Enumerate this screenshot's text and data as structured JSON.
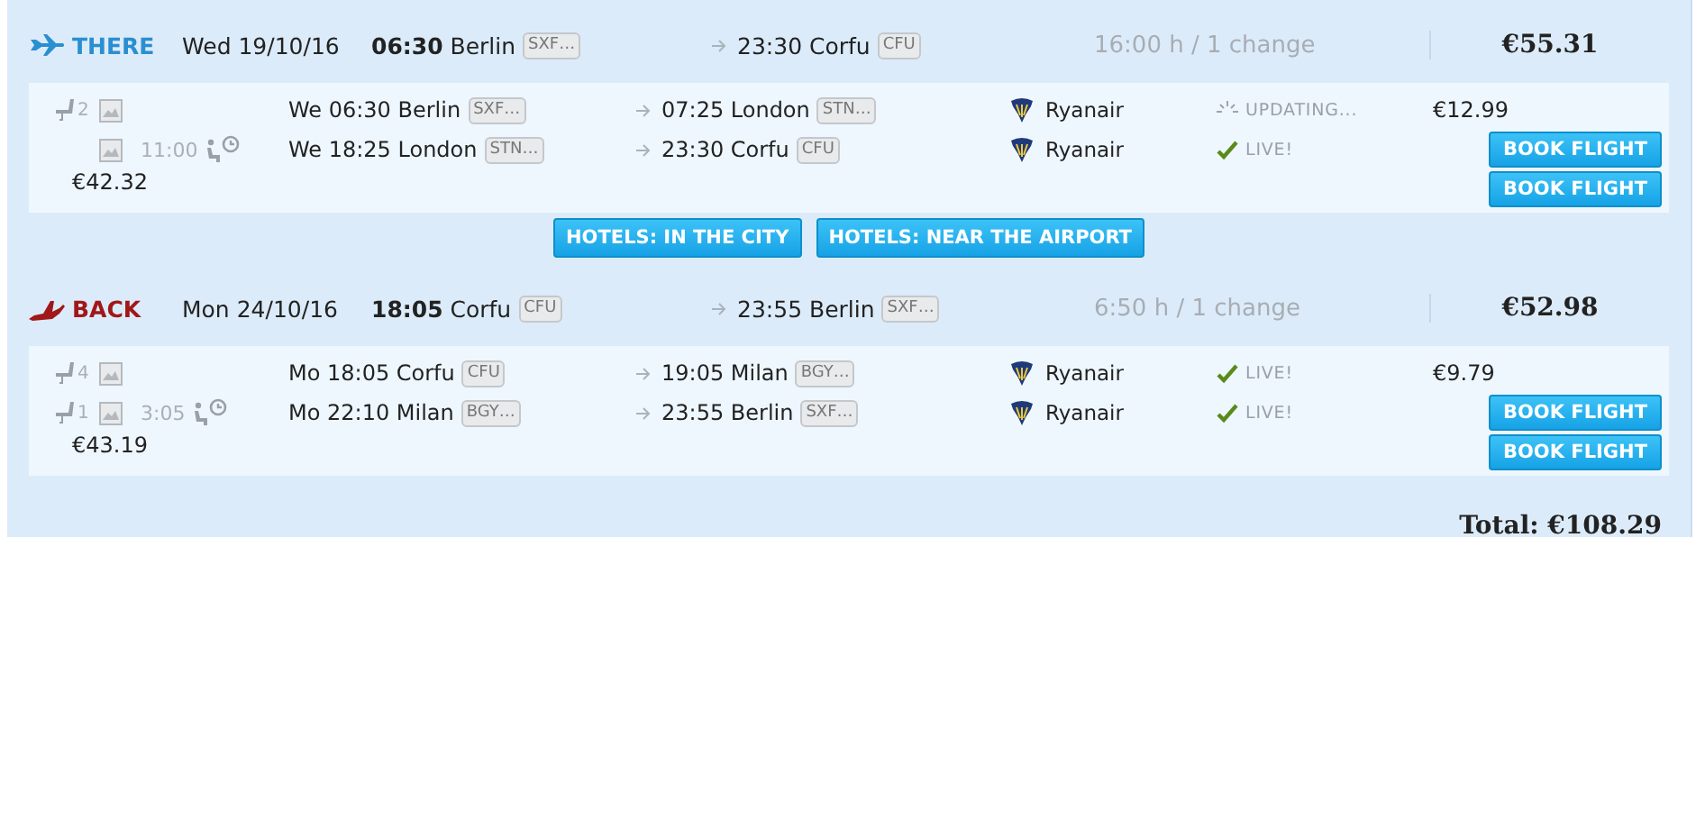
{
  "legs": [
    {
      "kind": "there",
      "label": "THERE",
      "date": "Wed 19/10/16",
      "dep_time": "06:30",
      "dep_city": "Berlin",
      "dep_code": "SXF…",
      "arrival": "23:30 Corfu",
      "arr_code": "CFU",
      "duration": "16:00 h / 1 change",
      "price": "€55.31",
      "subtotal": "€42.32",
      "fare": "€12.99",
      "book_buttons": [
        "BOOK FLIGHT",
        "BOOK FLIGHT"
      ],
      "segments": [
        {
          "seats": "2",
          "departure": "We 06:30 Berlin",
          "dep_code": "SXF…",
          "arrival": "07:25 London",
          "arr_code": "STN…",
          "airline": "Ryanair",
          "status": {
            "kind": "updating",
            "label": "UPDATING..."
          }
        },
        {
          "layover": "11:00",
          "departure": "We 18:25 London",
          "dep_code": "STN…",
          "arrival": "23:30 Corfu",
          "arr_code": "CFU",
          "airline": "Ryanair",
          "status": {
            "kind": "live",
            "label": "LIVE!"
          }
        }
      ]
    },
    {
      "kind": "back",
      "label": "BACK",
      "date": "Mon 24/10/16",
      "dep_time": "18:05",
      "dep_city": "Corfu",
      "dep_code": "CFU",
      "arrival": "23:55 Berlin",
      "arr_code": "SXF…",
      "duration": "6:50 h / 1 change",
      "price": "€52.98",
      "subtotal": "€43.19",
      "fare": "€9.79",
      "book_buttons": [
        "BOOK FLIGHT",
        "BOOK FLIGHT"
      ],
      "segments": [
        {
          "seats": "4",
          "departure": "Mo 18:05 Corfu",
          "dep_code": "CFU",
          "arrival": "19:05 Milan",
          "arr_code": "BGY…",
          "airline": "Ryanair",
          "status": {
            "kind": "live",
            "label": "LIVE!"
          }
        },
        {
          "seats": "1",
          "layover": "3:05",
          "departure": "Mo 22:10 Milan",
          "dep_code": "BGY…",
          "arrival": "23:55 Berlin",
          "arr_code": "SXF…",
          "airline": "Ryanair",
          "status": {
            "kind": "live",
            "label": "LIVE!"
          }
        }
      ]
    }
  ],
  "hotel_buttons": [
    "HOTELS: IN THE CITY",
    "HOTELS: NEAR THE AIRPORT"
  ],
  "total": "Total: €108.29"
}
